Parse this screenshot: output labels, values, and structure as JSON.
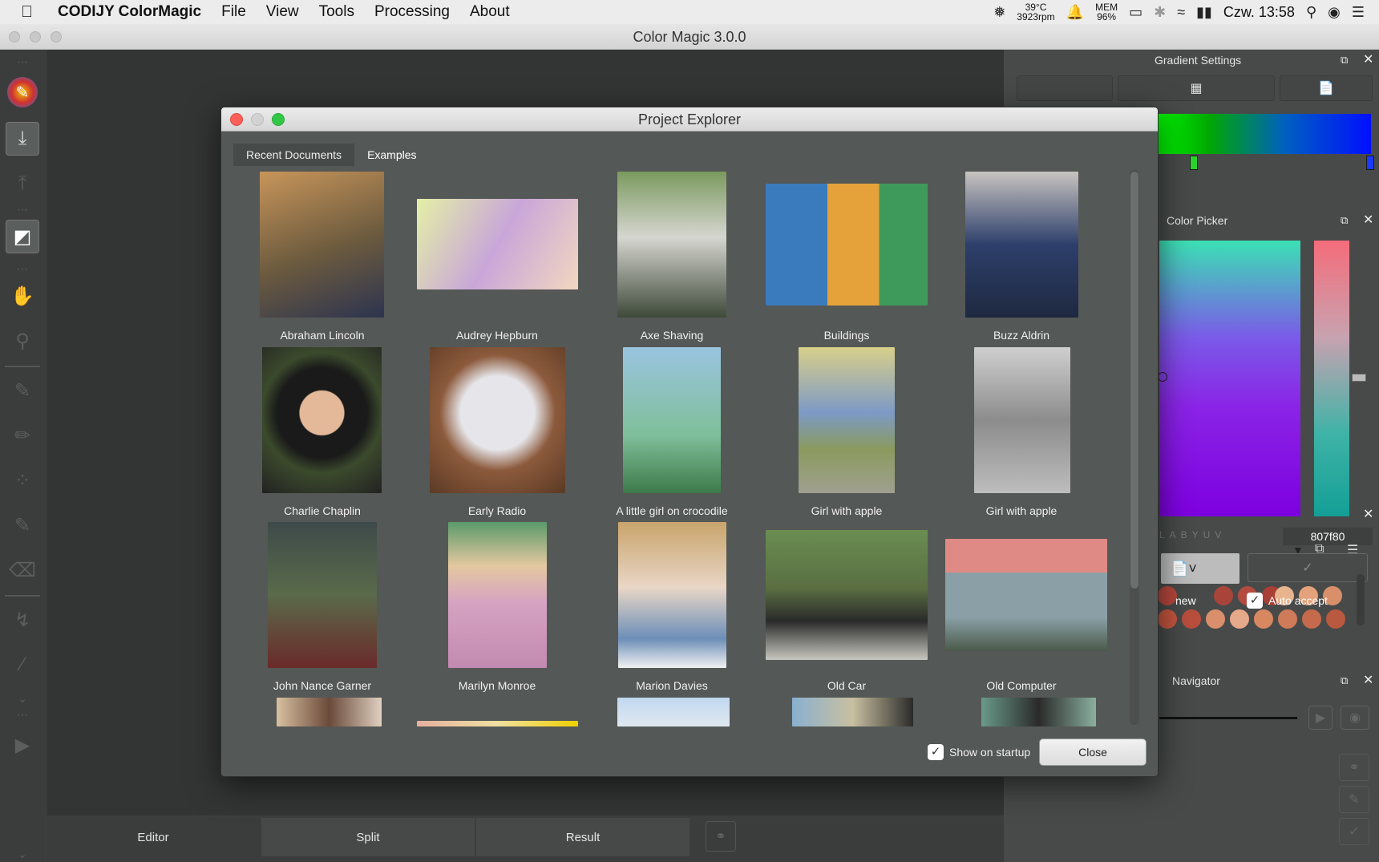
{
  "menubar": {
    "app_name": "CODIJY ColorMagic",
    "items": [
      "File",
      "View",
      "Tools",
      "Processing",
      "About"
    ],
    "temp": "39°C",
    "rpm": "3923rpm",
    "mem_label": "MEM",
    "mem_value": "96%",
    "clock": "Czw. 13:58"
  },
  "window": {
    "title": "Color Magic 3.0.0"
  },
  "right_panel": {
    "gradient_title": "Gradient Settings",
    "color_picker_title": "Color Picker",
    "hex_value": "807f80",
    "new_label": "new",
    "auto_accept_label": "Auto accept",
    "navigator_title": "Navigator"
  },
  "bottom_tabs": {
    "editor": "Editor",
    "split": "Split",
    "result": "Result"
  },
  "dialog": {
    "title": "Project Explorer",
    "tabs": {
      "recent": "Recent Documents",
      "examples": "Examples"
    },
    "items": [
      {
        "caption": "Abraham Lincoln",
        "color": "#6b5a3e"
      },
      {
        "caption": "Audrey Hepburn",
        "color": "#c9a6d9"
      },
      {
        "caption": "Axe Shaving",
        "color": "#5e7a4a"
      },
      {
        "caption": "Buildings",
        "color": "#3a7bbd"
      },
      {
        "caption": "Buzz Aldrin",
        "color": "#2d3f6b"
      },
      {
        "caption": "Charlie Chaplin",
        "color": "#3b3e2c"
      },
      {
        "caption": "Early Radio",
        "color": "#8c5a3c"
      },
      {
        "caption": "A little girl on crocodile",
        "color": "#7fbf9a"
      },
      {
        "caption": "Girl with apple",
        "color": "#8a9a5e"
      },
      {
        "caption": "Girl with apple",
        "color": "#8c8c8c"
      },
      {
        "caption": "John Nance Garner",
        "color": "#5a6a4a"
      },
      {
        "caption": "Marilyn Monroe",
        "color": "#d6a3c2"
      },
      {
        "caption": "Marion Davies",
        "color": "#c9a46b"
      },
      {
        "caption": "Old Car",
        "color": "#5a6e42"
      },
      {
        "caption": "Old Computer",
        "color": "#8aa0a6"
      }
    ],
    "show_on_startup_label": "Show on startup",
    "close_label": "Close"
  }
}
